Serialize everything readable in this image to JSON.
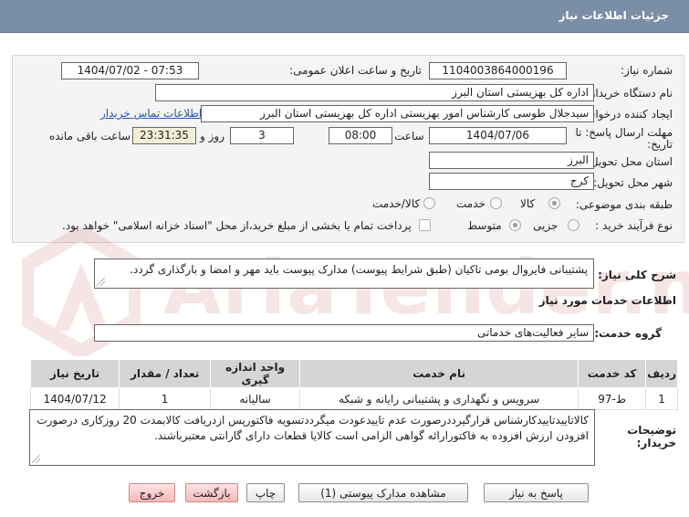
{
  "header": {
    "title": "جزئیات اطلاعات نیاز"
  },
  "labels": {
    "need_number": "شماره نیاز:",
    "announce_datetime": "تاریخ و ساعت اعلان عمومی:",
    "buyer_org": "نام دستگاه خریدار:",
    "requester": "ایجاد کننده درخواست:",
    "contact_link": "اطلاعات تماس خریدار",
    "deadline_line1": "مهلت ارسال پاسخ: تا",
    "deadline_line2": "تاریخ:",
    "time": "ساعت",
    "days_and": "روز و",
    "remaining": "ساعت باقی مانده",
    "province": "استان محل تحویل:",
    "city": "شهر محل تحویل:",
    "category": "طبقه بندی موضوعی:",
    "process_type": "نوع فرآیند خرید :",
    "summary": "شرح کلی نیاز:",
    "services_info": "اطلاعات خدمات مورد نیاز",
    "service_group": "گروه خدمت:",
    "buyer_notes_line1": "توضیحات",
    "buyer_notes_line2": "خریدار:"
  },
  "values": {
    "need_number": "1104003864000196",
    "announce_datetime": "1404/07/02 - 07:53",
    "buyer_org": "اداره کل بهزیستی استان البرز",
    "requester": "سیدجلال طوسی کارشناس امور بهزیستی اداره کل بهزیستی استان البرز",
    "deadline_date": "1404/07/06",
    "deadline_time": "08:00",
    "days": "3",
    "remaining_time": "23:31:35",
    "province": "البرز",
    "city": "کرج",
    "service_group": "سایر فعالیت‌های خدماتی",
    "summary": "پشتیبانی فایروال بومی تاکیان (طبق شرایط پیوست) مدارک پیوست باید مهر و امضا و بارگذاری گردد.",
    "buyer_notes": "کالاتاییدتاییدکارشناس قرارگیرددرصورت عدم تاییدعودت میگرددتسویه فاکتورپس ازدریافت کالابمدت 20 روزکاری درصورت افزودن ارزش افزوده به فاکتورارائه گواهی الزامی است کالایا قطعات دارای گارانتی معتبرباشند."
  },
  "category_options": [
    {
      "label": "کالا",
      "checked": true
    },
    {
      "label": "خدمت",
      "checked": false
    },
    {
      "label": "کالا/خدمت",
      "checked": false
    }
  ],
  "process_options": [
    {
      "label": "جزیی",
      "checked": false
    },
    {
      "label": "متوسط",
      "checked": true
    }
  ],
  "payment_note": "پرداخت تمام یا بخشی از مبلغ خرید،از محل \"اسناد خزانه اسلامی\" خواهد بود.",
  "table": {
    "headers": [
      "ردیف",
      "کد خدمت",
      "نام خدمت",
      "واحد اندازه گیری",
      "تعداد / مقدار",
      "تاریخ نیاز"
    ],
    "rows": [
      [
        "1",
        "ط-97",
        "سرویس و نگهداری و پشتیبانی رایانه و شبکه",
        "سالیانه",
        "1",
        "1404/07/12"
      ]
    ]
  },
  "buttons": {
    "reply": "پاسخ به نیاز",
    "attachments": "مشاهده مدارک پیوستی (1)",
    "print": "چاپ",
    "back": "بازگشت",
    "exit": "خروج"
  },
  "watermark": {
    "text": "AriaTender.net"
  },
  "colors": {
    "header": "#7a8ea5",
    "panel": "#f4f4f4",
    "link": "#2a55b8",
    "accent_btn": "#f6b8b8"
  }
}
